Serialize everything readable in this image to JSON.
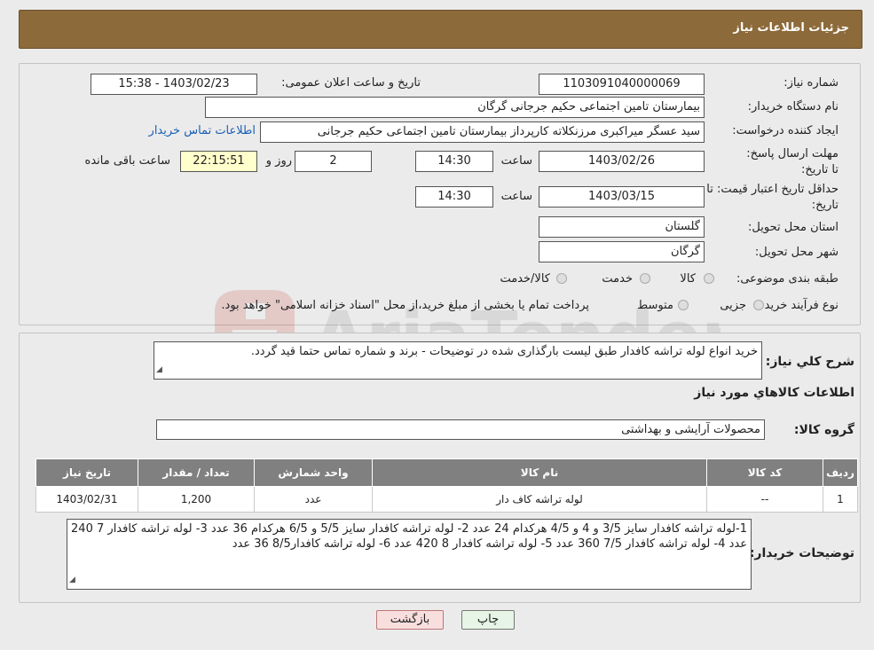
{
  "header": {
    "title": "جزئیات اطلاعات نیاز"
  },
  "form": {
    "need_number_label": "شماره نیاز:",
    "need_number": "1103091040000069",
    "announce_label": "تاریخ و ساعت اعلان عمومی:",
    "announce_value": "1403/02/23 - 15:38",
    "buyer_org_label": "نام دستگاه خریدار:",
    "buyer_org": "بیمارستان تامین اجتماعی حکیم جرجانی گرگان",
    "creator_label": "ایجاد کننده درخواست:",
    "creator": "سید عسگر میراکبری مرزنکلاته کارپرداز بیمارستان تامین اجتماعی حکیم جرجانی",
    "contact_link": "اطلاعات تماس خریدار",
    "reply_deadline_label": "مهلت ارسال پاسخ: تا تاریخ:",
    "reply_date": "1403/02/26",
    "time_label": "ساعت",
    "reply_time": "14:30",
    "days_value": "2",
    "days_label": "روز و",
    "remaining_time": "22:15:51",
    "remaining_label": "ساعت باقی مانده",
    "price_validity_label": "حداقل تاریخ اعتبار قیمت: تا تاریخ:",
    "price_date": "1403/03/15",
    "price_time": "14:30",
    "province_label": "استان محل تحویل:",
    "province": "گلستان",
    "city_label": "شهر محل تحویل:",
    "city": "گرگان",
    "category_label": "طبقه بندی موضوعی:",
    "category_options": [
      "کالا",
      "خدمت",
      "کالا/خدمت"
    ],
    "process_label": "نوع فرآیند خرید :",
    "process_options": [
      "جزیی",
      "متوسط"
    ],
    "process_note": "پرداخت تمام یا بخشی از مبلغ خرید،از محل \"اسناد خزانه اسلامی\" خواهد بود."
  },
  "details": {
    "description_label": "شرح کلي نياز:",
    "description": "خرید انواع لوله تراشه کافدار       طبق لیست بارگذاری شده در توضیحات - برند و شماره تماس حتما قید گردد.",
    "goods_info_title": "اطلاعات کالاهاي مورد نياز",
    "goods_group_label": "گروه کالا:",
    "goods_group": "محصولات آرایشی و بهداشتی",
    "table": {
      "headers": [
        "ردیف",
        "کد کالا",
        "نام کالا",
        "واحد شمارش",
        "تعداد / مقدار",
        "تاریخ نیاز"
      ],
      "rows": [
        [
          "1",
          "--",
          "لوله تراشه کاف دار",
          "عدد",
          "1,200",
          "1403/02/31"
        ]
      ]
    },
    "buyer_notes_label": "توضیحات خریدار:",
    "buyer_notes": "1-لوله تراشه کافدار سایز 3/5 و 4 و 4/5    هرکدام 24 عدد 2- لوله تراشه کافدار سایز 5/5 و 6/5    هرکدام 36 عدد 3- لوله تراشه کافدار 7     240 عدد 4- لوله تراشه کافدار 7/5    360 عدد  5- لوله تراشه کافدار 8     420 عدد 6- لوله تراشه کافدار8/5 36 عدد"
  },
  "buttons": {
    "print": "چاپ",
    "back": "بازگشت"
  },
  "watermark": {
    "text": "AriaTender.neT"
  }
}
